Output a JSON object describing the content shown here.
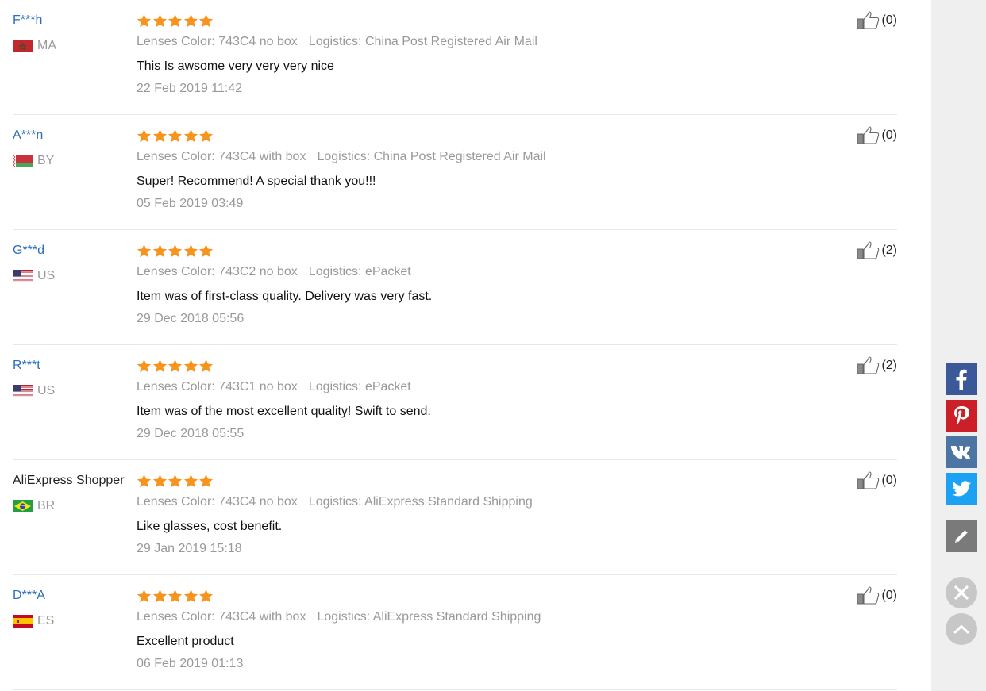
{
  "reviews": [
    {
      "user": "F***h",
      "country": "MA",
      "flag": "morocco-flag",
      "rating": 5,
      "lenses_color": "Lenses Color: 743C4 no box",
      "logistics": "Logistics: China Post Registered Air Mail",
      "comment": "This Is awsome very very very nice",
      "date": "22 Feb 2019 11:42",
      "helpful": "(0)"
    },
    {
      "user": "A***n",
      "country": "BY",
      "flag": "belarus-flag",
      "rating": 5,
      "lenses_color": "Lenses Color: 743C4 with box",
      "logistics": "Logistics: China Post Registered Air Mail",
      "comment": "Super! Recommend! A special thank you!!!",
      "date": "05 Feb 2019 03:49",
      "helpful": "(0)"
    },
    {
      "user": "G***d",
      "country": "US",
      "flag": "us-flag",
      "rating": 5,
      "lenses_color": "Lenses Color: 743C2 no box",
      "logistics": "Logistics: ePacket",
      "comment": "Item was of first-class quality. Delivery was very fast.",
      "date": "29 Dec 2018 05:56",
      "helpful": "(2)"
    },
    {
      "user": "R***t",
      "country": "US",
      "flag": "us-flag",
      "rating": 5,
      "lenses_color": "Lenses Color: 743C1 no box",
      "logistics": "Logistics: ePacket",
      "comment": "Item was of the most excellent quality! Swift to send.",
      "date": "29 Dec 2018 05:55",
      "helpful": "(2)"
    },
    {
      "user": "AliExpress Shopper",
      "country": "BR",
      "flag": "brazil-flag",
      "rating": 5,
      "lenses_color": "Lenses Color: 743C4 no box",
      "logistics": "Logistics: AliExpress Standard Shipping",
      "comment": "Like glasses, cost benefit.",
      "date": "29 Jan 2019 15:18",
      "helpful": "(0)"
    },
    {
      "user": "D***A",
      "country": "ES",
      "flag": "spain-flag",
      "rating": 5,
      "lenses_color": "Lenses Color: 743C4 with box",
      "logistics": "Logistics: AliExpress Standard Shipping",
      "comment": "Excellent product",
      "date": "06 Feb 2019 01:13",
      "helpful": "(0)"
    }
  ],
  "side_buttons": {
    "facebook": {
      "icon": "facebook-icon",
      "color": "#3b5998"
    },
    "pinterest": {
      "icon": "pinterest-icon",
      "color": "#cb2027"
    },
    "vk": {
      "icon": "vk-icon",
      "color": "#4c75a3"
    },
    "twitter": {
      "icon": "twitter-icon",
      "color": "#1da1f2"
    },
    "edit": {
      "icon": "pencil-icon",
      "color": "#7a7a7a"
    },
    "close": {
      "icon": "close-icon",
      "color": "#c7c7c7"
    },
    "scroll_top": {
      "icon": "chevron-up-icon",
      "color": "#c7c7c7"
    }
  },
  "colors": {
    "star": "#f7941d",
    "link": "#2a6ebb",
    "muted": "#999999"
  }
}
